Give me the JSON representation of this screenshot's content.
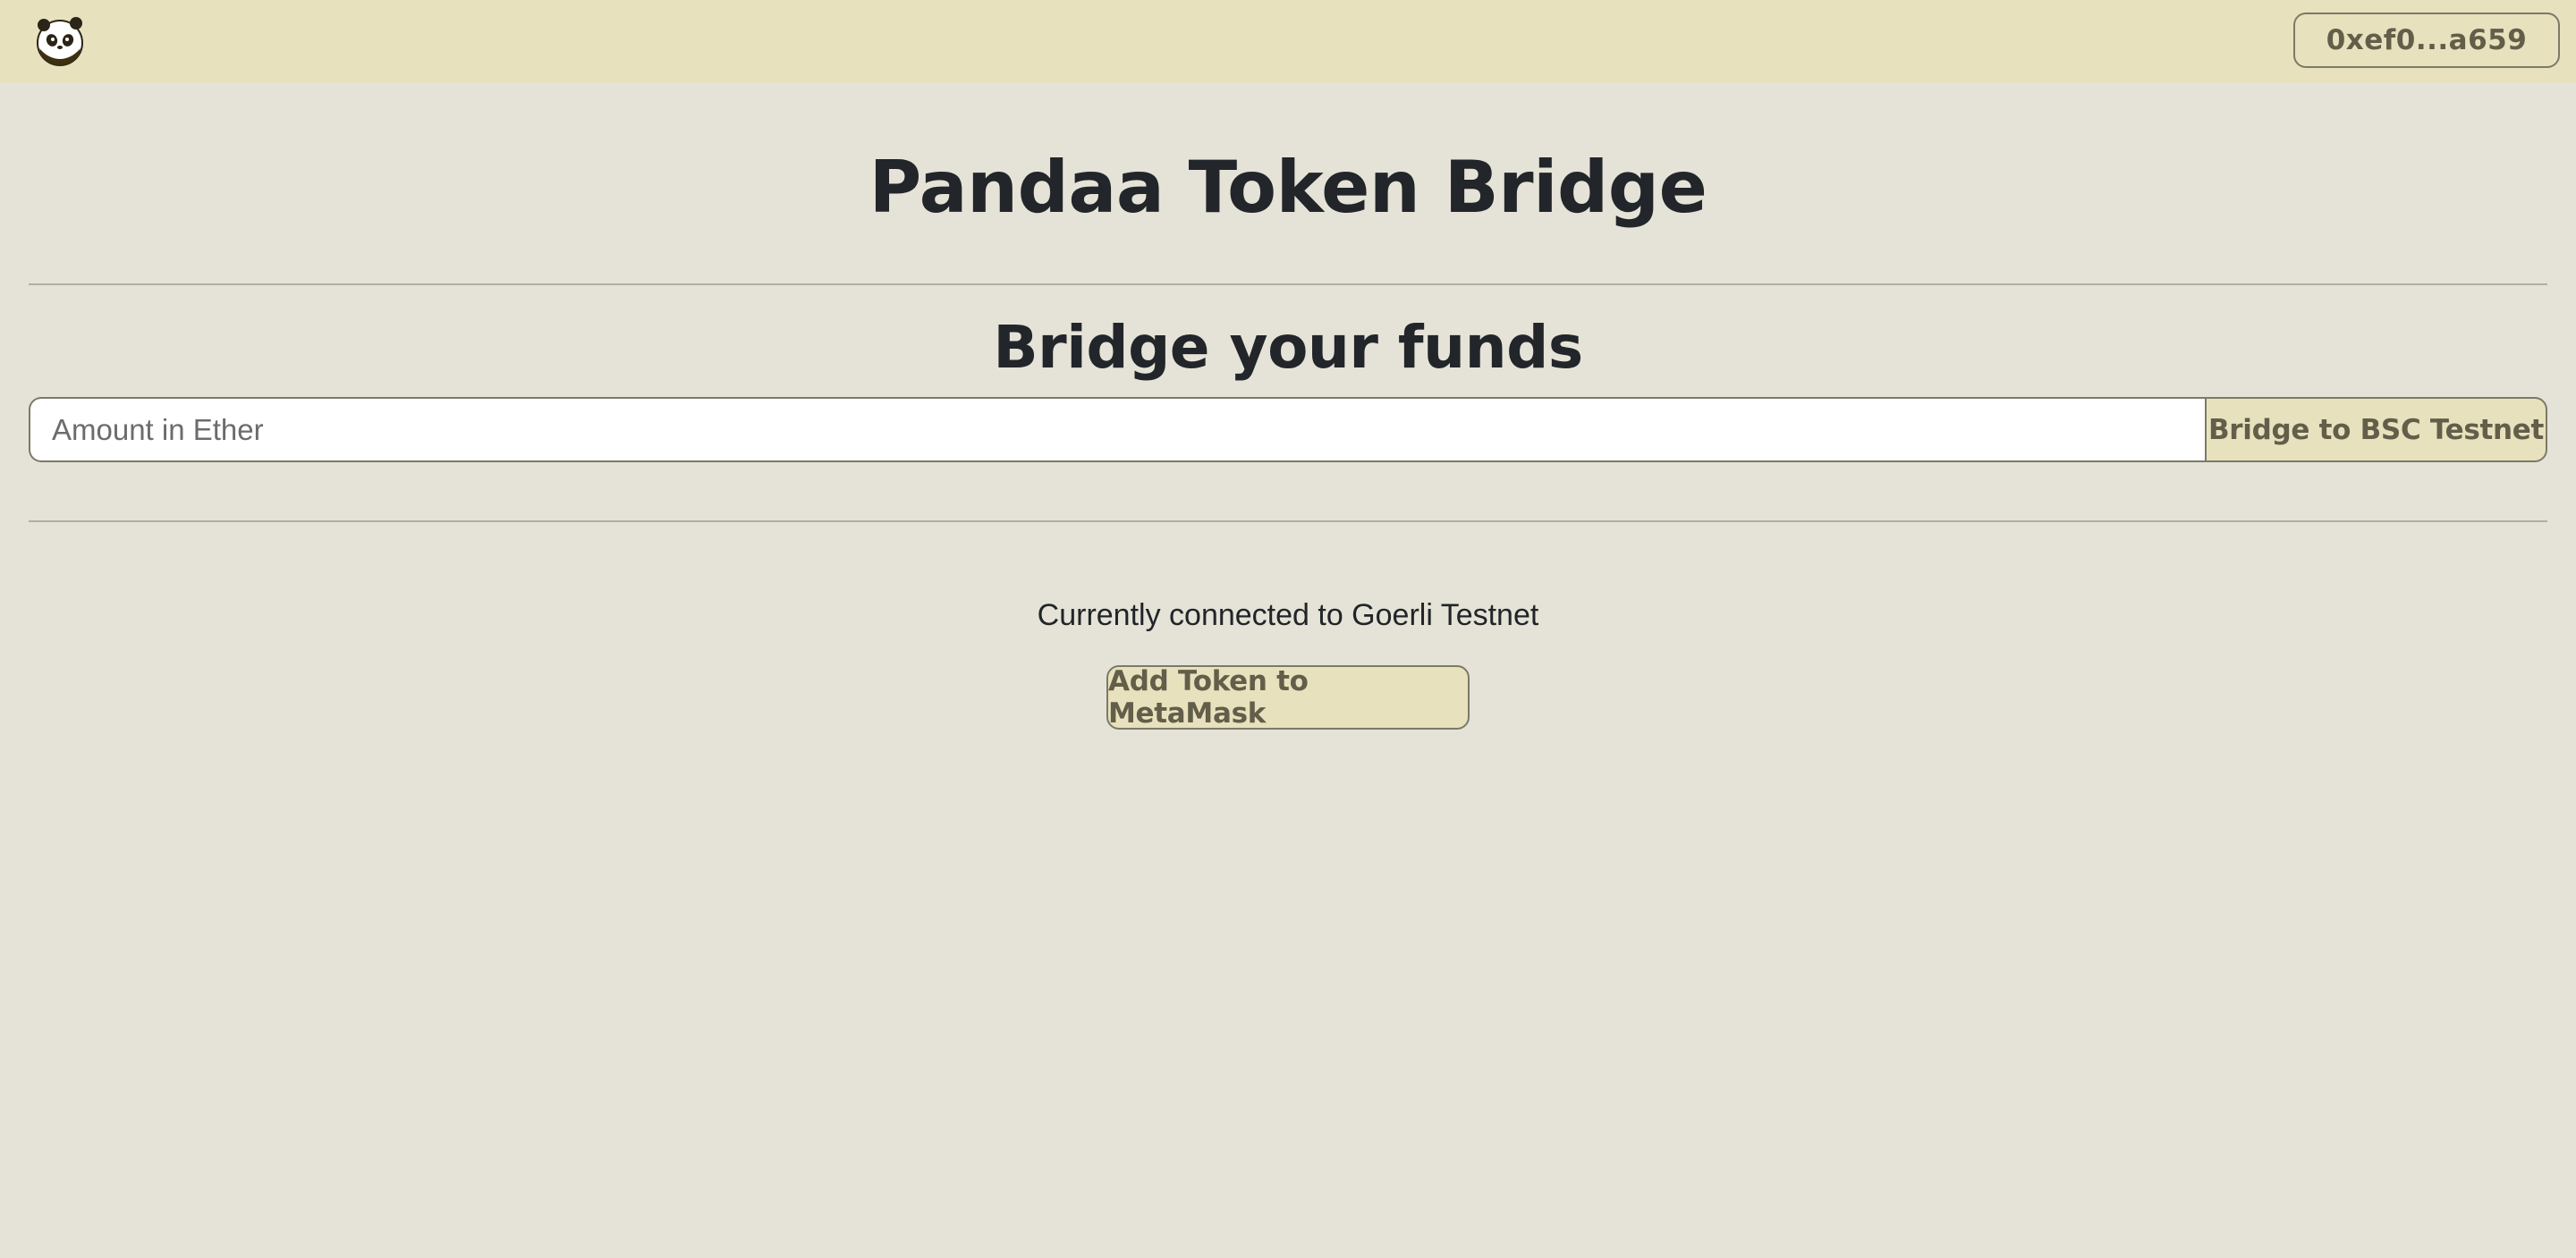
{
  "navbar": {
    "logo_icon": "panda-logo-icon",
    "wallet_address": "0xef0...a659"
  },
  "main": {
    "title": "Pandaa Token Bridge",
    "subtitle": "Bridge your funds",
    "amount_input": {
      "placeholder": "Amount in Ether",
      "value": ""
    },
    "bridge_button_label": "Bridge to BSC Testnet",
    "network_status": "Currently connected to Goerli Testnet",
    "add_token_button_label": "Add Token to MetaMask"
  },
  "colors": {
    "navbar_bg": "#e8e1bd",
    "page_bg": "#e5e3d7",
    "button_bg": "#e8e1bd",
    "button_text": "#625e4a",
    "border": "#7b7a68"
  }
}
